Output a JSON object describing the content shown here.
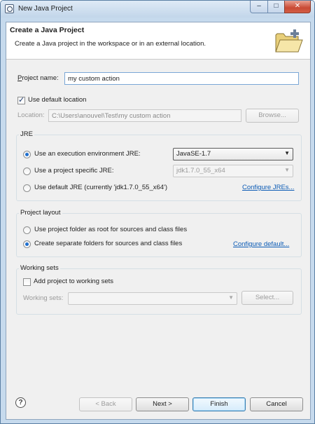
{
  "window": {
    "title": "New Java Project",
    "minimize_glyph": "–",
    "maximize_glyph": "□",
    "close_glyph": "✕"
  },
  "header": {
    "title": "Create a Java Project",
    "description": "Create a Java project in the workspace or in an external location."
  },
  "project": {
    "name_label": "Project name:",
    "name_value": "my custom action",
    "use_default_label": "Use default location",
    "use_default_checked": true,
    "location_label": "Location:",
    "location_value": "C:\\Users\\anouvel\\Test\\my custom action",
    "browse_label": "Browse..."
  },
  "jre": {
    "group_title": "JRE",
    "option_env_label": "Use an execution environment JRE:",
    "option_env_value": "JavaSE-1.7",
    "option_specific_label": "Use a project specific JRE:",
    "option_specific_value": "jdk1.7.0_55_x64",
    "option_default_label": "Use default JRE (currently 'jdk1.7.0_55_x64')",
    "configure_link": "Configure JREs...",
    "selected": "execution-environment"
  },
  "layout": {
    "group_title": "Project layout",
    "option_root_label": "Use project folder as root for sources and class files",
    "option_separate_label": "Create separate folders for sources and class files",
    "configure_link": "Configure default...",
    "selected": "separate-folders"
  },
  "working_sets": {
    "group_title": "Working sets",
    "add_label": "Add project to working sets",
    "add_checked": false,
    "sets_label": "Working sets:",
    "sets_value": "",
    "select_label": "Select..."
  },
  "footer": {
    "help_glyph": "?",
    "back_label": "< Back",
    "next_label": "Next >",
    "finish_label": "Finish",
    "cancel_label": "Cancel"
  },
  "colors": {
    "accent": "#1f6fcf",
    "link": "#0b5bb5",
    "frame": "#c6daed"
  }
}
